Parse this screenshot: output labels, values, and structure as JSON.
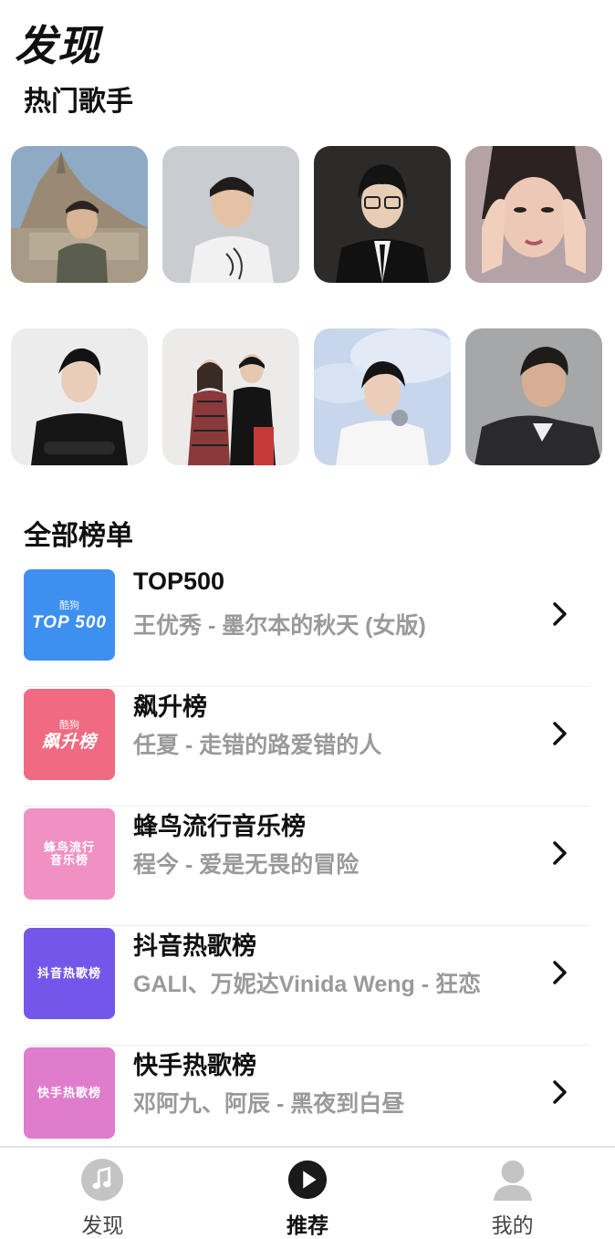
{
  "page_title": "发现",
  "hot_singers": {
    "title": "热门歌手",
    "items": [
      {
        "icon": "singer-photo"
      },
      {
        "icon": "singer-photo"
      },
      {
        "icon": "singer-photo"
      },
      {
        "icon": "singer-photo"
      },
      {
        "icon": "singer-photo"
      },
      {
        "icon": "singer-photo"
      },
      {
        "icon": "singer-photo"
      },
      {
        "icon": "singer-photo"
      }
    ]
  },
  "charts": {
    "title": "全部榜单",
    "items": [
      {
        "name": "TOP500",
        "song": "王优秀 - 墨尔本的秋天 (女版)",
        "cover_brand": "酷狗",
        "cover_text": "TOP 500",
        "cover_color": "#3d8ff0"
      },
      {
        "name": "飙升榜",
        "song": "任夏 - 走错的路爱错的人",
        "cover_brand": "酷狗",
        "cover_text": "飙升榜",
        "cover_color": "#f06b82"
      },
      {
        "name": "蜂鸟流行音乐榜",
        "song": "程今 - 爱是无畏的冒险",
        "cover_brand": "",
        "cover_text": "蜂鸟流行\n音乐榜",
        "cover_color": "#f191c3"
      },
      {
        "name": "抖音热歌榜",
        "song": "GALI、万妮达Vinida Weng - 狂恋",
        "cover_brand": "",
        "cover_text": "抖音热歌榜",
        "cover_color": "#7457ea"
      },
      {
        "name": "快手热歌榜",
        "song": "邓阿九、阿辰 - 黑夜到白昼",
        "cover_brand": "",
        "cover_text": "快手热歌榜",
        "cover_color": "#e07ccc"
      }
    ]
  },
  "tabbar": {
    "tabs": [
      {
        "label": "发现",
        "icon": "music-note-icon",
        "active": false
      },
      {
        "label": "推荐",
        "icon": "play-icon",
        "active": true
      },
      {
        "label": "我的",
        "icon": "user-icon",
        "active": false
      }
    ]
  },
  "colors": {
    "accent": "#111111",
    "muted": "#9a9a9a",
    "divider": "#ececec"
  }
}
